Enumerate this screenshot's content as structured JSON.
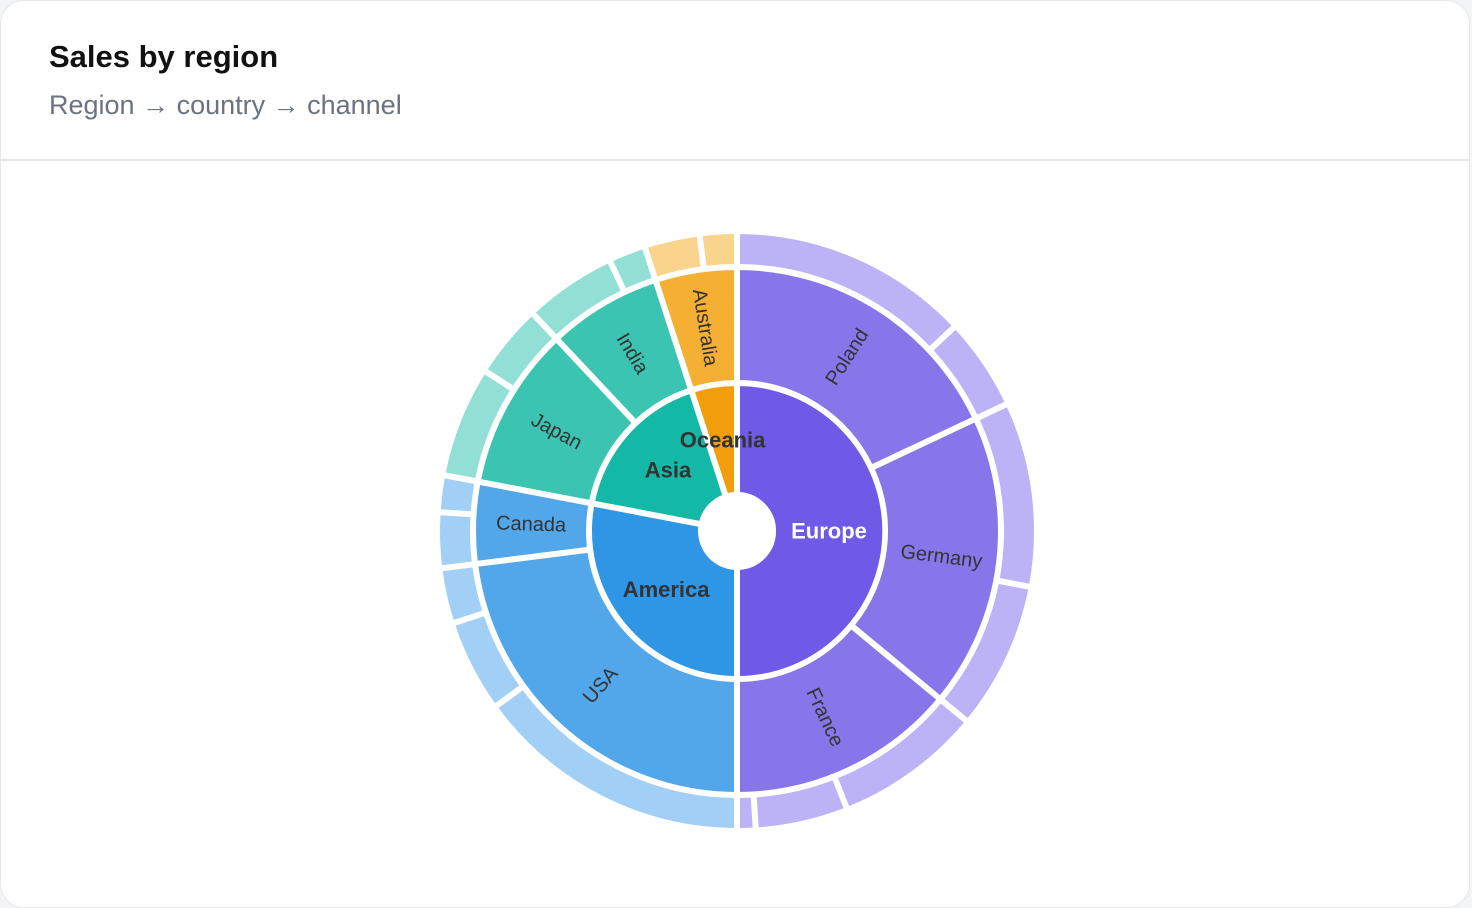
{
  "header": {
    "title": "Sales by region",
    "subtitle": "Region → country → channel"
  },
  "chart_data": {
    "type": "sunburst",
    "levels": [
      "Region",
      "country",
      "channel"
    ],
    "children": [
      {
        "name": "Europe",
        "color": "#6e5ae6",
        "value": 50,
        "children": [
          {
            "name": "Poland",
            "color": "#8776e9",
            "value": 18,
            "children": [
              {
                "value": 13
              },
              {
                "value": 5
              }
            ]
          },
          {
            "name": "Germany",
            "color": "#8776e9",
            "value": 18,
            "children": [
              {
                "value": 10
              },
              {
                "value": 8
              }
            ]
          },
          {
            "name": "France",
            "color": "#8776e9",
            "value": 14,
            "children": [
              {
                "value": 8
              },
              {
                "value": 5
              },
              {
                "value": 1
              }
            ]
          }
        ]
      },
      {
        "name": "America",
        "color": "#2f96e6",
        "value": 28,
        "children": [
          {
            "name": "USA",
            "color": "#52a7ea",
            "value": 23,
            "children": [
              {
                "value": 15
              },
              {
                "value": 5
              },
              {
                "value": 3
              }
            ]
          },
          {
            "name": "Canada",
            "color": "#52a7ea",
            "value": 5,
            "children": [
              {
                "value": 3
              },
              {
                "value": 2
              }
            ]
          }
        ]
      },
      {
        "name": "Asia",
        "color": "#14b8a6",
        "value": 17,
        "children": [
          {
            "name": "Japan",
            "color": "#3cc4b3",
            "value": 10,
            "children": [
              {
                "value": 6
              },
              {
                "value": 4
              }
            ]
          },
          {
            "name": "India",
            "color": "#3cc4b3",
            "value": 7,
            "children": [
              {
                "value": 5
              },
              {
                "value": 2
              }
            ]
          }
        ]
      },
      {
        "name": "Oceania",
        "color": "#f29e0c",
        "value": 5,
        "children": [
          {
            "name": "Australia",
            "color": "#f5af32",
            "value": 5,
            "children": [
              {
                "value": 3
              },
              {
                "value": 2
              }
            ]
          }
        ]
      }
    ],
    "outer_colors": {
      "Europe": "#bcb2f6",
      "America": "#a2cff5",
      "Asia": "#92e0d5",
      "Oceania": "#fad38d"
    },
    "label_colors": {
      "region": "#333333",
      "region_on_dark": "#ffffff",
      "country": "#333333"
    }
  }
}
